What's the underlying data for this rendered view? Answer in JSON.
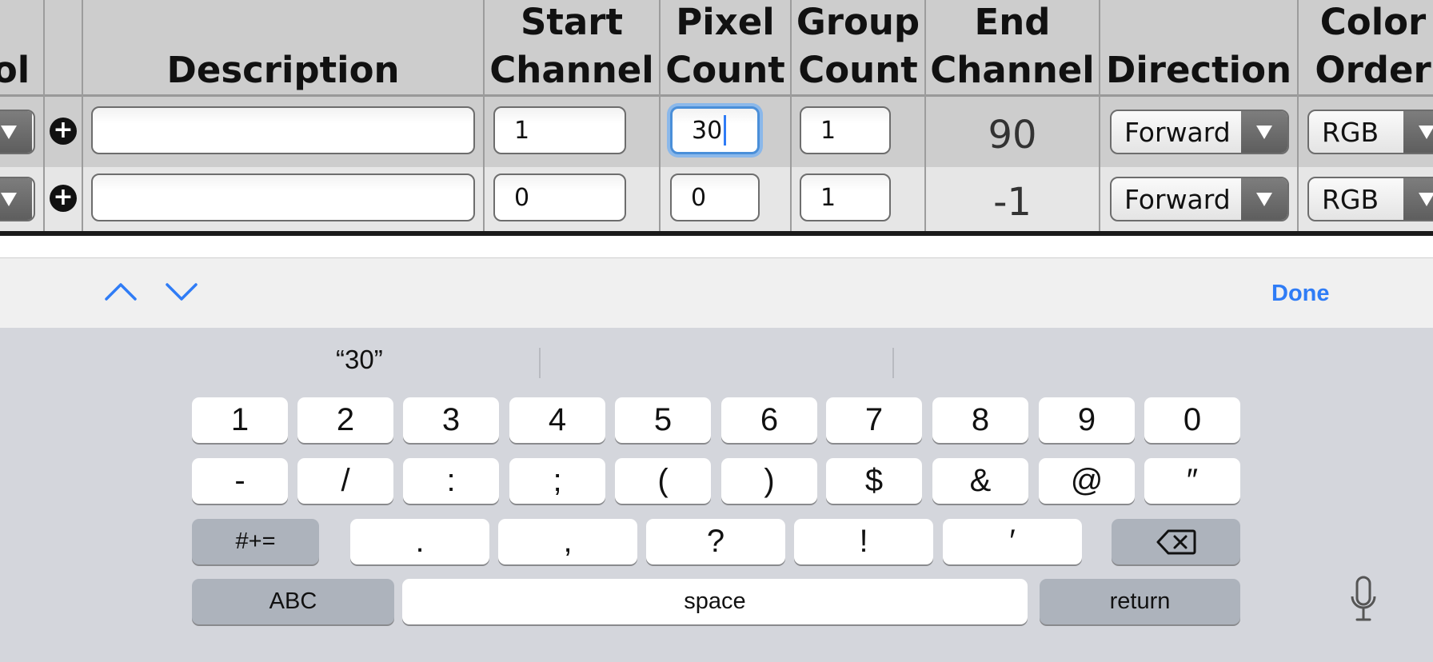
{
  "table": {
    "headers": {
      "protocol_partial": "ol",
      "description": "Description",
      "start_channel": [
        "Start",
        "Channel"
      ],
      "pixel_count": [
        "Pixel",
        "Count"
      ],
      "group_count": [
        "Group",
        "Count"
      ],
      "end_channel": [
        "End",
        "Channel"
      ],
      "direction": "Direction",
      "color_order": [
        "Color",
        "Order"
      ]
    },
    "rows": [
      {
        "description": "",
        "start_channel": "1",
        "pixel_count": "30",
        "group_count": "1",
        "end_channel": "90",
        "direction": "Forward",
        "color_order": "RGB",
        "pixel_count_focused": true
      },
      {
        "description": "",
        "start_channel": "0",
        "pixel_count": "0",
        "group_count": "1",
        "end_channel": "-1",
        "direction": "Forward",
        "color_order": "RGB",
        "pixel_count_focused": false
      }
    ],
    "add_glyph": "+"
  },
  "accessory_bar": {
    "prev_icon": "chevron-up-icon",
    "next_icon": "chevron-down-icon",
    "done_label": "Done",
    "accent_color": "#2f7cf6"
  },
  "keyboard": {
    "suggestion": "“30”",
    "row1": [
      "1",
      "2",
      "3",
      "4",
      "5",
      "6",
      "7",
      "8",
      "9",
      "0"
    ],
    "row2": [
      "-",
      "/",
      ":",
      ";",
      "(",
      ")",
      "$",
      "&",
      "@",
      "″"
    ],
    "row3": {
      "symbols_label": "#+=",
      "punct": [
        ".",
        ",",
        "?",
        "!",
        "′"
      ],
      "delete_icon": "backspace-icon"
    },
    "row4": {
      "abc_label": "ABC",
      "space_label": "space",
      "return_label": "return"
    },
    "mic_icon": "microphone-icon"
  }
}
